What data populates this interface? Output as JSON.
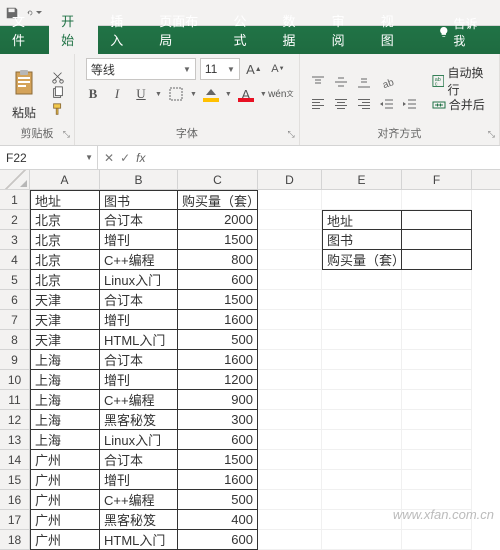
{
  "qat": {
    "save": "floppy-icon",
    "undo": "undo-icon",
    "redo": "redo-icon",
    "more": "chevron-down-icon"
  },
  "tabs": {
    "file": "文件",
    "home": "开始",
    "insert": "插入",
    "layout": "页面布局",
    "formulas": "公式",
    "data": "数据",
    "review": "审阅",
    "view": "视图",
    "tell": "告诉我"
  },
  "ribbon": {
    "clipboard": {
      "paste": "粘贴",
      "label": "剪贴板"
    },
    "font": {
      "name": "等线",
      "size": "11",
      "label": "字体"
    },
    "alignment": {
      "wrap": "自动换行",
      "merge": "合并后",
      "label": "对齐方式"
    }
  },
  "namebox": "F22",
  "formula": "",
  "columns": [
    "A",
    "B",
    "C",
    "D",
    "E",
    "F"
  ],
  "rows": [
    {
      "n": 1,
      "A": "地址",
      "B": "图书",
      "C": "购买量（套）",
      "E": "",
      "F": ""
    },
    {
      "n": 2,
      "A": "北京",
      "B": "合订本",
      "C": 2000,
      "E": "地址",
      "F": ""
    },
    {
      "n": 3,
      "A": "北京",
      "B": "增刊",
      "C": 1500,
      "E": "图书",
      "F": ""
    },
    {
      "n": 4,
      "A": "北京",
      "B": "C++编程",
      "C": 800,
      "E": "购买量（套）",
      "F": ""
    },
    {
      "n": 5,
      "A": "北京",
      "B": "Linux入门",
      "C": 600
    },
    {
      "n": 6,
      "A": "天津",
      "B": "合订本",
      "C": 1500
    },
    {
      "n": 7,
      "A": "天津",
      "B": "增刊",
      "C": 1600
    },
    {
      "n": 8,
      "A": "天津",
      "B": "HTML入门",
      "C": 500
    },
    {
      "n": 9,
      "A": "上海",
      "B": "合订本",
      "C": 1600
    },
    {
      "n": 10,
      "A": "上海",
      "B": "增刊",
      "C": 1200
    },
    {
      "n": 11,
      "A": "上海",
      "B": "C++编程",
      "C": 900
    },
    {
      "n": 12,
      "A": "上海",
      "B": "黑客秘笈",
      "C": 300
    },
    {
      "n": 13,
      "A": "上海",
      "B": "Linux入门",
      "C": 600
    },
    {
      "n": 14,
      "A": "广州",
      "B": "合订本",
      "C": 1500
    },
    {
      "n": 15,
      "A": "广州",
      "B": "增刊",
      "C": 1600
    },
    {
      "n": 16,
      "A": "广州",
      "B": "C++编程",
      "C": 500
    },
    {
      "n": 17,
      "A": "广州",
      "B": "黑客秘笈",
      "C": 400
    },
    {
      "n": 18,
      "A": "广州",
      "B": "HTML入门",
      "C": 600
    }
  ],
  "watermark": "www.xfan.com.cn"
}
